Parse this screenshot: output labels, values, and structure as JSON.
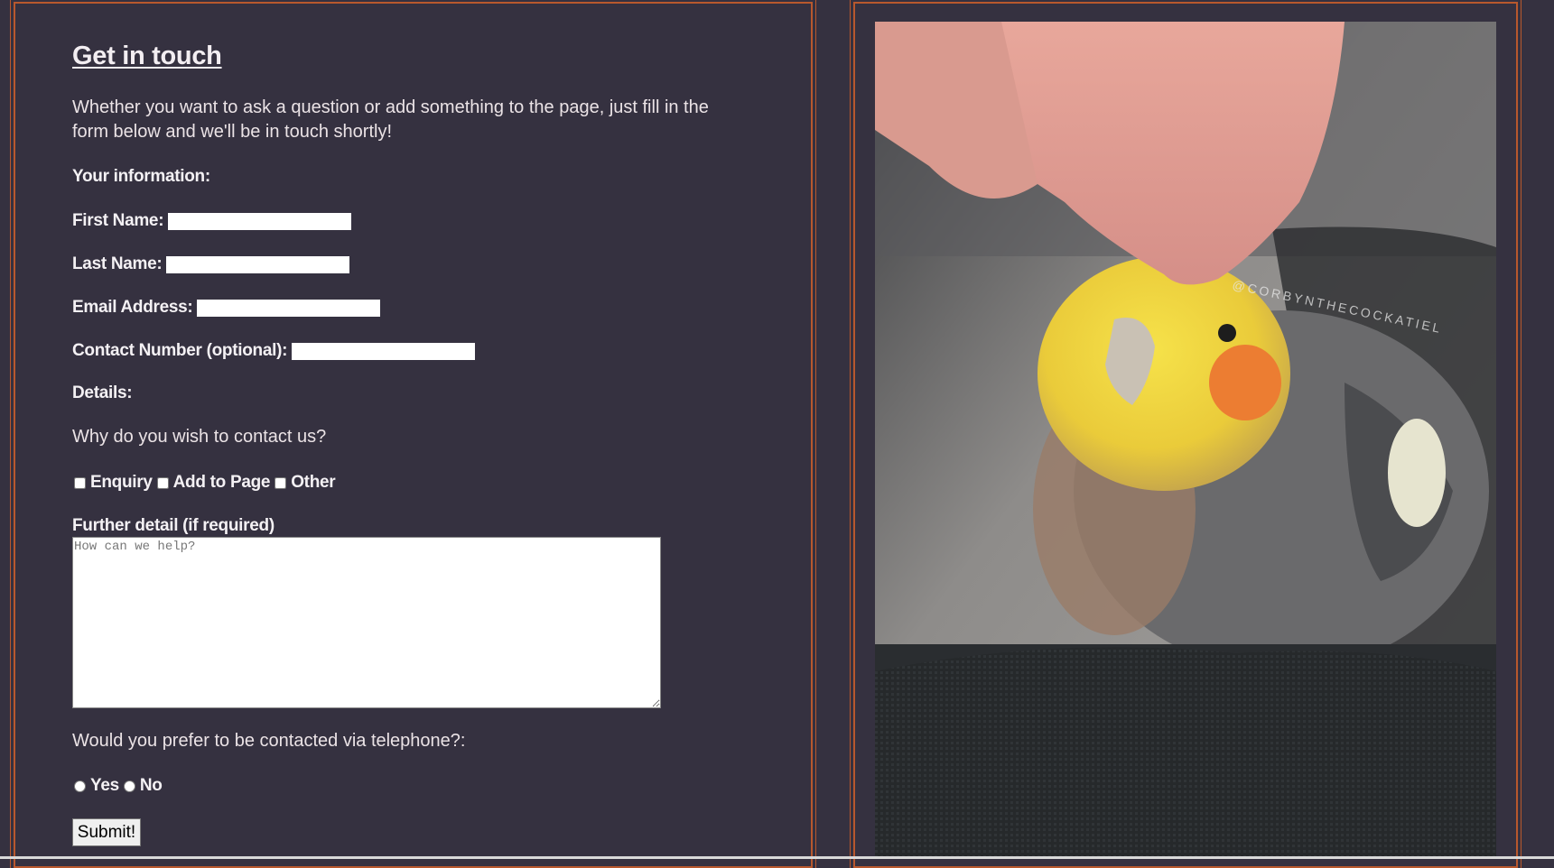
{
  "form": {
    "title": "Get in touch",
    "intro": "Whether you want to ask a question or add something to the page, just fill in the form below and we'll be in touch shortly!",
    "info_heading": "Your information:",
    "first_name_label": "First Name:",
    "last_name_label": "Last Name:",
    "email_label": "Email Address:",
    "contact_label": "Contact Number (optional):",
    "details_heading": "Details:",
    "why_question": "Why do you wish to contact us?",
    "checkboxes": [
      "Enquiry",
      "Add to Page",
      "Other"
    ],
    "further_label": "Further detail (if required)",
    "further_placeholder": "How can we help?",
    "phone_question": "Would you prefer to be contacted via telephone?:",
    "radios": [
      "Yes",
      "No"
    ],
    "submit_label": "Submit!"
  },
  "photo": {
    "watermark": "@CORBYNTHECOCKATIEL"
  },
  "colors": {
    "background": "#353140",
    "border_accent": "#b8582d"
  }
}
